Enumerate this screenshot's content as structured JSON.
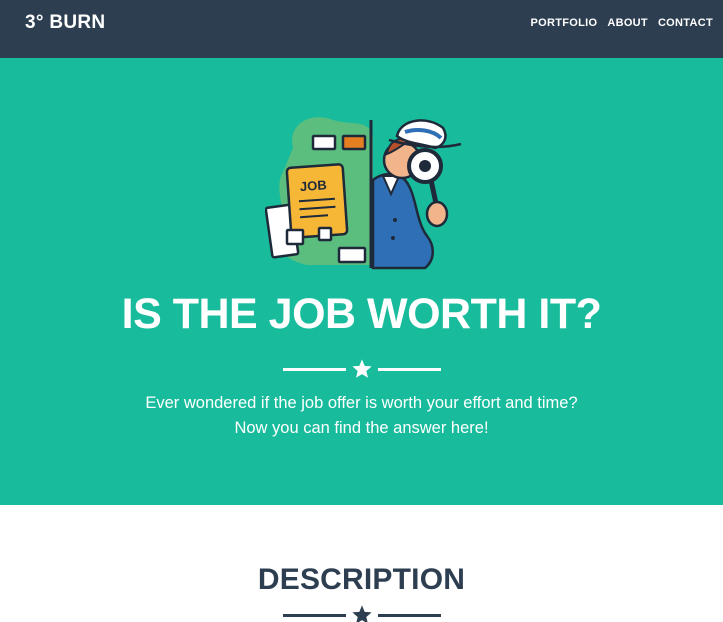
{
  "navbar": {
    "brand": "3° BURN",
    "links": [
      "PORTFOLIO",
      "ABOUT",
      "CONTACT"
    ],
    "background": "#2c3e50"
  },
  "hero": {
    "illustration_icon": "detective-magnifying-glass-job-icon",
    "illustration_text": "JOB",
    "title": "IS THE JOB WORTH IT?",
    "divider_icon": "star-icon",
    "text_line1": "Ever wondered if the job offer is worth your effort and time?",
    "text_line2": "Now you can find the answer here!",
    "background": "#18bc9c"
  },
  "description": {
    "title": "DESCRIPTION",
    "divider_icon": "star-icon",
    "title_color": "#2c3e50"
  }
}
